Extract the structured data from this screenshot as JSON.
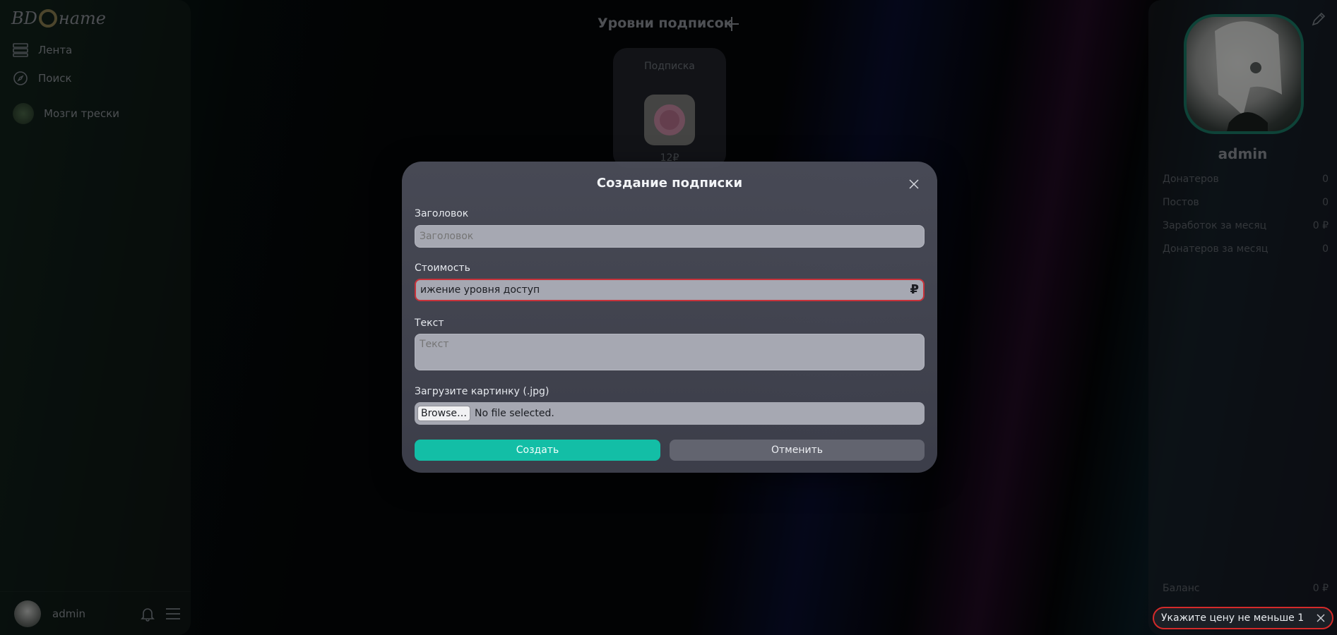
{
  "sidebar": {
    "logo": {
      "prefix": "BD",
      "suffix": "нате"
    },
    "items": [
      {
        "label": "Лента",
        "icon": "feed-icon"
      },
      {
        "label": "Поиск",
        "icon": "compass-icon"
      }
    ],
    "subscription_item": {
      "label": "Мозги трески"
    },
    "user": {
      "name": "admin"
    }
  },
  "main": {
    "title": "Уровни подписок",
    "card": {
      "title": "Подписка",
      "price": "12₽"
    }
  },
  "profile": {
    "name": "admin",
    "stats": [
      {
        "label": "Донатеров",
        "value": "0"
      },
      {
        "label": "Постов",
        "value": "0"
      },
      {
        "label": "Заработок за месяц",
        "value": "0 ₽"
      },
      {
        "label": "Донатеров за месяц",
        "value": "0"
      }
    ],
    "balance": {
      "label": "Баланс",
      "value": "0 ₽"
    }
  },
  "modal": {
    "title": "Создание подписки",
    "title_field": {
      "label": "Заголовок",
      "placeholder": "Заголовок"
    },
    "price_field": {
      "label": "Стоимость",
      "value": "ижение уровня доступ",
      "currency": "₽"
    },
    "text_field": {
      "label": "Текст",
      "placeholder": "Текст"
    },
    "image_field": {
      "label": "Загрузите картинку (.jpg)",
      "browse": "Browse…",
      "status": "No file selected."
    },
    "create_label": "Создать",
    "cancel_label": "Отменить"
  },
  "toast": {
    "message": "Укажите цену не меньше 1"
  },
  "colors": {
    "accent": "#13bea6",
    "error": "#c7323a"
  }
}
